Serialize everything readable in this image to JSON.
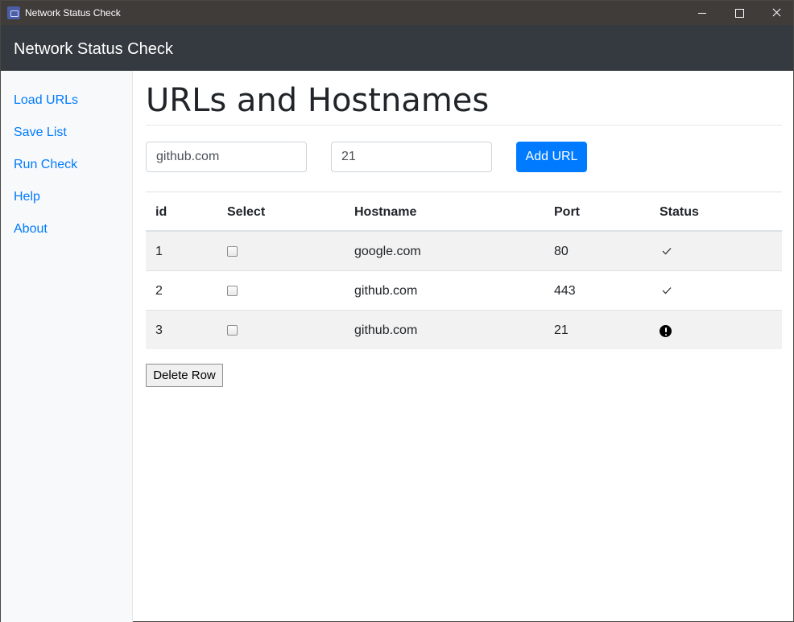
{
  "window": {
    "title": "Network Status Check",
    "controls": [
      "minimize-icon",
      "maximize-icon",
      "close-icon"
    ]
  },
  "navbar": {
    "brand": "Network Status Check"
  },
  "sidebar": {
    "items": [
      {
        "label": "Load URLs"
      },
      {
        "label": "Save List"
      },
      {
        "label": "Run Check"
      },
      {
        "label": "Help"
      },
      {
        "label": "About"
      }
    ]
  },
  "main": {
    "title": "URLs and Hostnames",
    "form": {
      "hostname_value": "github.com",
      "port_value": "21",
      "add_button": "Add URL"
    },
    "table": {
      "headers": [
        "id",
        "Select",
        "Hostname",
        "Port",
        "Status"
      ],
      "rows": [
        {
          "id": "1",
          "selected": false,
          "hostname": "google.com",
          "port": "80",
          "status": "ok",
          "status_icon": "check-icon"
        },
        {
          "id": "2",
          "selected": false,
          "hostname": "github.com",
          "port": "443",
          "status": "ok",
          "status_icon": "check-icon"
        },
        {
          "id": "3",
          "selected": false,
          "hostname": "github.com",
          "port": "21",
          "status": "error",
          "status_icon": "alert-circle-icon"
        }
      ]
    },
    "delete_button": "Delete Row"
  },
  "colors": {
    "titlebar": "#3f3c39",
    "navbar": "#343a40",
    "sidebar": "#f8f9fa",
    "link": "#007bff",
    "primary": "#007bff",
    "stripe": "#f2f2f2"
  }
}
